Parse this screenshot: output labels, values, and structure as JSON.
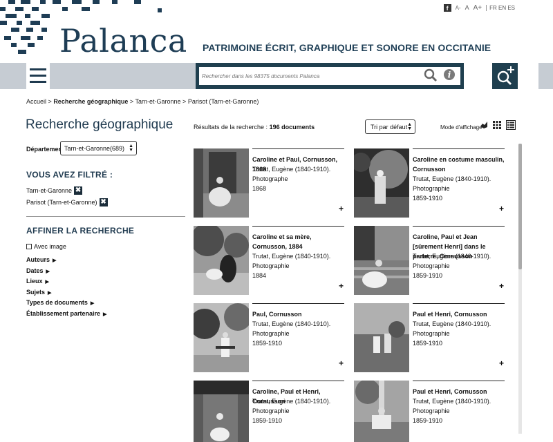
{
  "brand": {
    "logo_text": "Palanca",
    "tagline": "PATRIMOINE ÉCRIT, GRAPHIQUE ET SONORE EN OCCITANIE",
    "color": "#1e3d55"
  },
  "topbar": {
    "font_small": "A-",
    "font_normal": "A",
    "font_large": "A+",
    "languages": "FR EN ES"
  },
  "search": {
    "placeholder": "Rechercher dans les 98375 documents Palanca"
  },
  "breadcrumb": {
    "home": "Accueil",
    "sep": ">",
    "current_search": "Recherche géographique",
    "level1": "Tarn-et-Garonne",
    "level2": "Parisot (Tarn-et-Garonne)"
  },
  "sidebar": {
    "title": "Recherche géographique",
    "dept_label": "Département",
    "dept_value": "Tarn-et-Garonne(689)",
    "filtered_heading": "VOUS AVEZ FILTRÉ :",
    "filters": [
      "Tarn-et-Garonne",
      "Parisot (Tarn-et-Garonne)"
    ],
    "refine_heading": "AFFINER LA RECHERCHE",
    "with_image": "Avec image",
    "facets": [
      "Auteurs",
      "Dates",
      "Lieux",
      "Sujets",
      "Types de documents",
      "Établissement partenaire"
    ]
  },
  "results": {
    "count_label": "Résultats de la recherche :",
    "count_value": "196 documents",
    "sort_value": "Tri par défaut",
    "display_mode_label": "Mode d'affichage",
    "items": [
      {
        "title": "Caroline et Paul, Cornusson, 1868",
        "author": "Trutat, Eugène (1840-1910).",
        "type": "Photographe",
        "date": "1868"
      },
      {
        "title": "Caroline en costume masculin, Cornusson",
        "author": "Trutat, Eugène (1840-1910).",
        "type": "Photographie",
        "date": "1859-1910"
      },
      {
        "title": "Caroline et sa mère, Cornusson, 1884",
        "author": "Trutat, Eugène (1840-1910).",
        "type": "Photographie",
        "date": "1884"
      },
      {
        "title": "Caroline, Paul et Jean [sûrement Henri] dans le parterre, Cornusson",
        "author": "Trutat, Eugène (1840-1910).",
        "type": "Photographie",
        "date": "1859-1910"
      },
      {
        "title": "Paul, Cornusson",
        "author": "Trutat, Eugène (1840-1910).",
        "type": "Photographie",
        "date": "1859-1910"
      },
      {
        "title": "Paul et Henri, Cornusson",
        "author": "Trutat, Eugène (1840-1910).",
        "type": "Photographie",
        "date": "1859-1910"
      },
      {
        "title": "Caroline, Paul et Henri, Cornusson",
        "author": "Trutat, Eugène (1840-1910).",
        "type": "Photographie",
        "date": "1859-1910"
      },
      {
        "title": "Paul et Henri, Cornusson",
        "author": "Trutat, Eugène (1840-1910).",
        "type": "Photographie",
        "date": "1859-1910"
      }
    ],
    "plus_symbol": "+",
    "remove_symbol": "✖"
  },
  "icons": {
    "menu": "hamburger-icon",
    "search": "magnifier-icon",
    "info": "info-icon",
    "advanced_search": "magnifier-plus-icon",
    "facebook": "facebook-icon",
    "grid": "grid-view-icon",
    "list": "list-view-icon"
  }
}
